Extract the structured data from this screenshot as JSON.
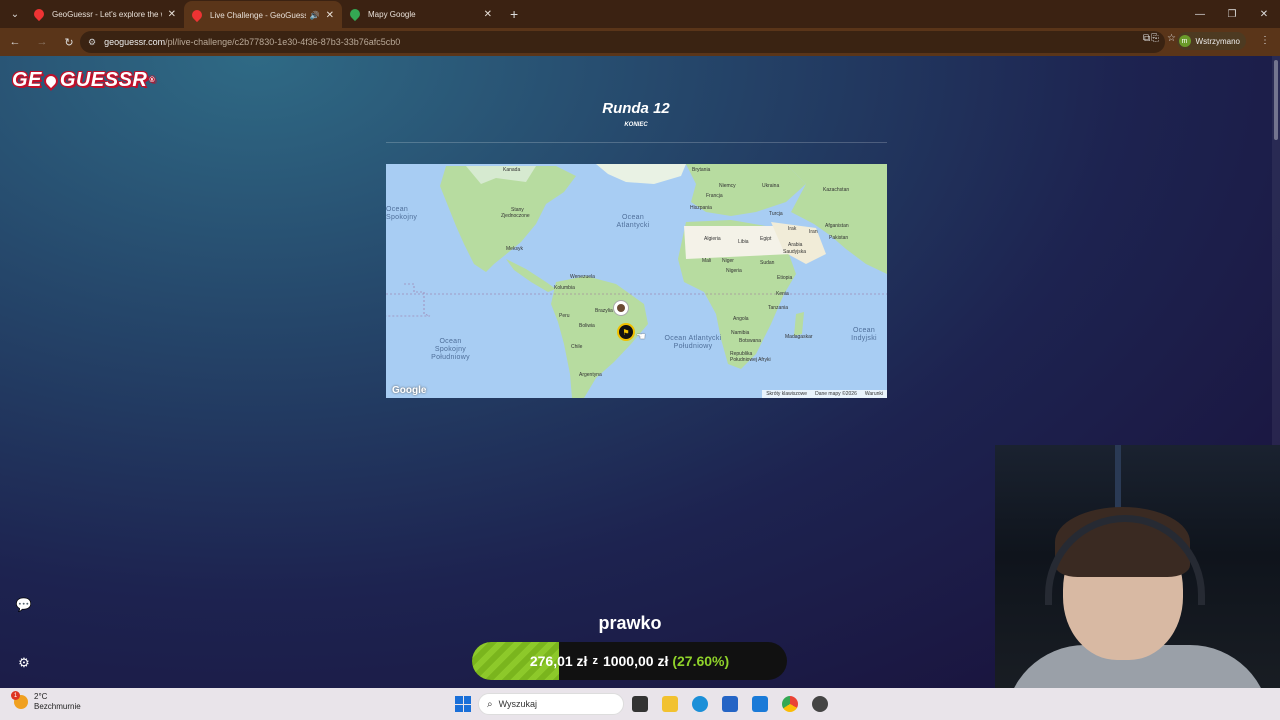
{
  "browser": {
    "tabs": [
      {
        "title": "GeoGuessr - Let's explore the w",
        "active": false
      },
      {
        "title": "Live Challenge - GeoGuessr",
        "active": true
      },
      {
        "title": "Mapy Google",
        "active": false
      }
    ],
    "url_host": "geoguessr.com",
    "url_path": "/pl/live-challenge/c2b77830-1e30-4f36-87b3-33b76afc5cb0",
    "profile_initial": "m",
    "profile_label": "Wstrzymano"
  },
  "game": {
    "logo": "GEOGUESSR",
    "round_title": "Runda 12",
    "round_status": "KONIEC",
    "player_name": "prawko",
    "progress": {
      "amount": "276,01 zł",
      "connector": "z",
      "total": "1000,00 zł",
      "percent_text": "(27.60%)",
      "fraction": 0.276
    }
  },
  "map": {
    "labels": {
      "kanada": "Kanada",
      "stany": "Stany",
      "zjednoczone": "Zjednoczone",
      "meksyk": "Meksyk",
      "kolumbia": "Kolumbia",
      "wenezuela": "Wenezuela",
      "brazylia": "Brazylia",
      "peru": "Peru",
      "boliwia": "Boliwia",
      "chile": "Chile",
      "argentyna": "Argentyna",
      "brytania": "Brytania",
      "niemcy": "Niemcy",
      "ukraina": "Ukraina",
      "francja": "Francja",
      "hiszpania": "Hiszpania",
      "kazachstan": "Kazachstan",
      "turcja": "Turcja",
      "afganistan": "Afganistan",
      "irak": "Irak",
      "iran": "Iran",
      "pakistan": "Pakistan",
      "algieria": "Algieria",
      "libia": "Libia",
      "egipt": "Egipt",
      "arabia": "Arabia",
      "saudyjska": "Saudyjska",
      "mali": "Mali",
      "niger": "Niger",
      "sudan": "Sudan",
      "nigeria": "Nigeria",
      "etiopia": "Etiopia",
      "kenia": "Kenia",
      "tanzania": "Tanzania",
      "angola": "Angola",
      "namibia": "Namibia",
      "botswana": "Botswana",
      "madagaskar": "Madagaskar",
      "rpa": "Republika Południowej Afryki"
    },
    "oceans": {
      "atl_n": "Ocean Atlantycki",
      "atl_s": "Ocean Atlantycki Południowy",
      "pac_n": "Ocean Spokojny",
      "pac_s": "Ocean Spokojny Południowy",
      "indian": "Ocean Indyjski"
    },
    "google": "Google",
    "footer": {
      "shortcuts": "Skróty klawiszowe",
      "data": "Dane mapy ©2026",
      "terms": "Warunki"
    },
    "colors": {
      "water": "#a8cdf3",
      "land": "#b7dca0",
      "desert": "#f4f2e8"
    }
  },
  "taskbar": {
    "temperature": "2°C",
    "weather": "Bezchmurnie",
    "weather_badge": "1",
    "search_placeholder": "Wyszukaj"
  },
  "icons": [
    "tab-menu-icon",
    "close-icon",
    "speaker-icon",
    "plus-icon",
    "back-icon",
    "forward-icon",
    "reload-icon",
    "site-info-icon",
    "install-icon",
    "star-icon",
    "extensions-icon",
    "more-icon",
    "chat-icon",
    "gear-icon",
    "flag-icon",
    "search-icon",
    "windows-icon"
  ]
}
